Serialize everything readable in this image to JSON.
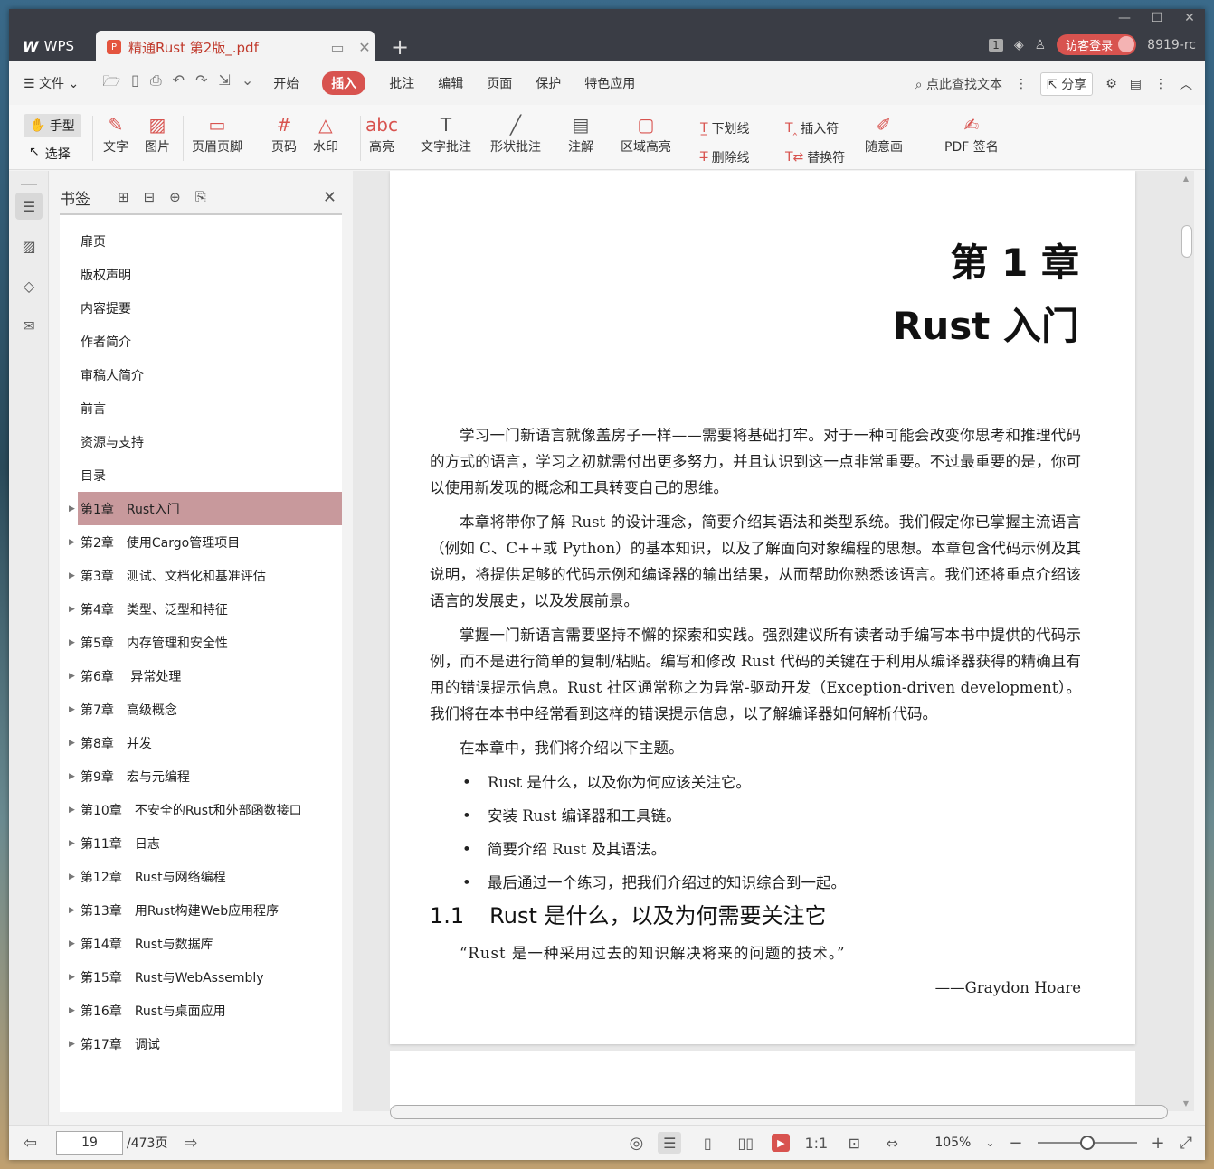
{
  "titlebar": {
    "app_label": "WPS",
    "doc_tab_title": "精通Rust 第2版_.pdf",
    "new_tab": "+",
    "page_badge": "1",
    "login_label": "访客登录",
    "version": "8919-rc"
  },
  "menubar": {
    "file": "文件",
    "tabs": [
      "开始",
      "插入",
      "批注",
      "编辑",
      "页面",
      "保护",
      "特色应用"
    ],
    "active_tab": "插入",
    "search": "点此查找文本",
    "share": "分享"
  },
  "ribbon": {
    "hand": "手型",
    "select": "选择",
    "text": "文字",
    "image": "图片",
    "header_footer": "页眉页脚",
    "page_num": "页码",
    "watermark": "水印",
    "highlight": "高亮",
    "text_note": "文字批注",
    "shape_note": "形状批注",
    "annotation": "注解",
    "area_highlight": "区域高亮",
    "underline": "下划线",
    "strikethrough": "删除线",
    "insert_char": "插入符",
    "replace_char": "替换符",
    "freehand": "随意画",
    "pdf_sign": "PDF 签名"
  },
  "bookmarks": {
    "title": "书签",
    "items": [
      {
        "label": "扉页",
        "arrow": false
      },
      {
        "label": "版权声明",
        "arrow": false
      },
      {
        "label": "内容提要",
        "arrow": false
      },
      {
        "label": "作者简介",
        "arrow": false
      },
      {
        "label": "审稿人简介",
        "arrow": false
      },
      {
        "label": "前言",
        "arrow": false
      },
      {
        "label": "资源与支持",
        "arrow": false
      },
      {
        "label": "目录",
        "arrow": false
      },
      {
        "label": "第1章　Rust入门",
        "arrow": true,
        "selected": true
      },
      {
        "label": "第2章　使用Cargo管理项目",
        "arrow": true
      },
      {
        "label": "第3章　测试、文档化和基准评估",
        "arrow": true
      },
      {
        "label": "第4章　类型、泛型和特征",
        "arrow": true
      },
      {
        "label": "第5章　内存管理和安全性",
        "arrow": true
      },
      {
        "label": "第6章　 异常处理",
        "arrow": true
      },
      {
        "label": "第7章　高级概念",
        "arrow": true
      },
      {
        "label": "第8章　并发",
        "arrow": true
      },
      {
        "label": "第9章　宏与元编程",
        "arrow": true
      },
      {
        "label": "第10章　不安全的Rust和外部函数接口",
        "arrow": true
      },
      {
        "label": "第11章　日志",
        "arrow": true
      },
      {
        "label": "第12章　Rust与网络编程",
        "arrow": true
      },
      {
        "label": "第13章　用Rust构建Web应用程序",
        "arrow": true
      },
      {
        "label": "第14章　Rust与数据库",
        "arrow": true
      },
      {
        "label": "第15章　Rust与WebAssembly",
        "arrow": true
      },
      {
        "label": "第16章　Rust与桌面应用",
        "arrow": true
      },
      {
        "label": "第17章　调试",
        "arrow": true
      }
    ]
  },
  "document": {
    "chapter_num": "第 1 章",
    "chapter_title": "Rust 入门",
    "paragraphs": [
      "学习一门新语言就像盖房子一样——需要将基础打牢。对于一种可能会改变你思考和推理代码的方式的语言，学习之初就需付出更多努力，并且认识到这一点非常重要。不过最重要的是，你可以使用新发现的概念和工具转变自己的思维。",
      "本章将带你了解 Rust 的设计理念，简要介绍其语法和类型系统。我们假定你已掌握主流语言（例如 C、C++或 Python）的基本知识，以及了解面向对象编程的思想。本章包含代码示例及其说明，将提供足够的代码示例和编译器的输出结果，从而帮助你熟悉该语言。我们还将重点介绍该语言的发展史，以及发展前景。",
      "掌握一门新语言需要坚持不懈的探索和实践。强烈建议所有读者动手编写本书中提供的代码示例，而不是进行简单的复制/粘贴。编写和修改 Rust 代码的关键在于利用从编译器获得的精确且有用的错误提示信息。Rust 社区通常称之为异常-驱动开发（Exception-driven development）。我们将在本书中经常看到这样的错误提示信息，以了解编译器如何解析代码。",
      "在本章中，我们将介绍以下主题。"
    ],
    "bullets": [
      "Rust 是什么，以及你为何应该关注它。",
      "安装 Rust 编译器和工具链。",
      "简要介绍 Rust 及其语法。",
      "最后通过一个练习，把我们介绍过的知识综合到一起。"
    ],
    "section_num": "1.1",
    "section_title": "Rust 是什么，以及为何需要关注它",
    "quote": "“Rust 是一种采用过去的知识解决将来的问题的技术。”",
    "attribution": "——Graydon Hoare"
  },
  "statusbar": {
    "current_page": "19",
    "total_pages": "/473页",
    "zoom": "105%",
    "zoom_fraction": 0.5
  }
}
